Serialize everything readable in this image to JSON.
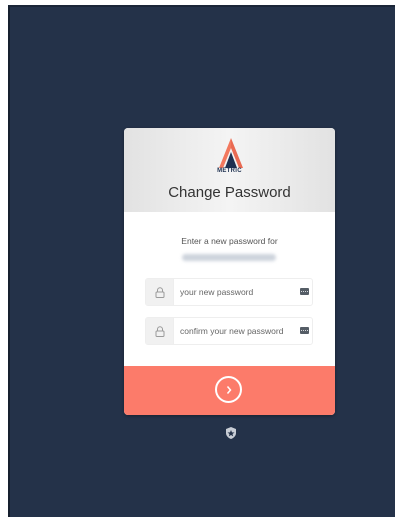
{
  "app": {
    "brand_name": "METRIC",
    "title": "Change Password"
  },
  "form": {
    "subtitle": "Enter a new password for",
    "new_password_placeholder": "your new password",
    "confirm_password_placeholder": "confirm your new password",
    "submit_icon": "chevron-right-icon"
  },
  "footer": {
    "badge_icon": "shield-badge-icon"
  },
  "colors": {
    "background": "#243249",
    "submit": "#fc7b6a",
    "logo_orange": "#f2785e",
    "logo_navy": "#1e3050"
  }
}
